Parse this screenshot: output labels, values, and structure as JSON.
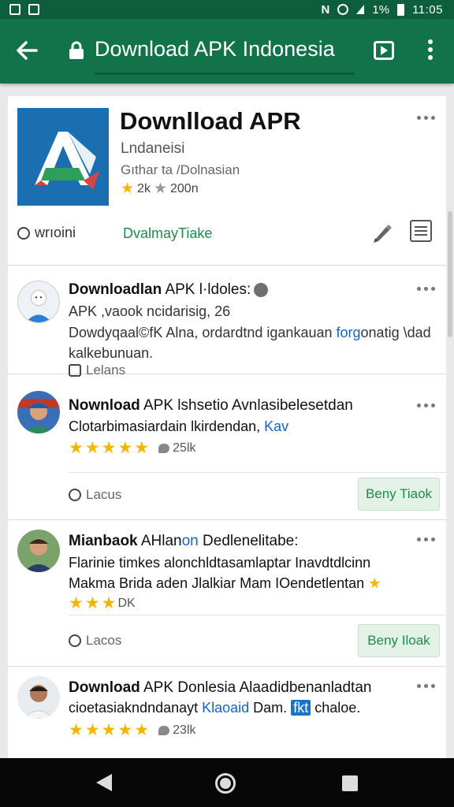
{
  "status_bar": {
    "signal_text": "1%",
    "time": "11:05"
  },
  "toolbar": {
    "back_icon": "arrow-left-icon",
    "lock_icon": "lock-icon",
    "title": "Download APK Indonesia",
    "tabs_icon": "tabs-icon",
    "menu_icon": "more-vert-icon"
  },
  "app": {
    "title": "Downlload APR",
    "subtitle": "Lndaneisi",
    "category": "Gıthar ta /Dolnasian",
    "rating": "2k",
    "downloads": "200n",
    "action_left": "wrıoini",
    "action_green": "DvalmayTiake",
    "icon_colors": {
      "bg": "#1b6fb0",
      "a": "#2f9e5a"
    }
  },
  "reviews": [
    {
      "name_bold": "Downloadlan",
      "name_rest": " APK l·ldoles:",
      "line1": "APK ,vaook ncidarisig, 26",
      "line2_pre": "Dowdyqaal©fK Alna, ordardtnd igankauan ",
      "line2_hl": "forg",
      "line2_post": "onatig \\dad",
      "line3": "kalkebunuan.",
      "meta": "Lelans"
    },
    {
      "name_bold": "Nownload",
      "name_rest": " APK lshsetio Avnlasibelesetdan",
      "line1_pre": "Clotarbimasiardain lkirdendan, ",
      "line1_hl": "Kav",
      "stars": 5,
      "count": "25lk",
      "meta": "Lacus",
      "button": "Beny Tiaok"
    },
    {
      "name_bold": "Mianbaok",
      "name_mid": " AHlan",
      "name_hl": "on",
      "name_rest": " Dedlenelitabe:",
      "line1": "Flarinie timkes alonchldtasamlaptar Inavdtdlcinn",
      "line2": "Makma Brida aden Jlalkiar Mam IOendetlentan",
      "stars": 3,
      "count": "DK",
      "meta": "Lacos",
      "button": "Beny Iloak"
    },
    {
      "name_bold": "Download",
      "name_rest": " APK Donlesia Alaadidbenanladtan",
      "line1_pre": "cioetasiakndndanayt ",
      "line1_hl": "Klaoaid",
      "line1_mid": " Dam. ",
      "line1_box": "fkt",
      "line1_post": " chaloe.",
      "stars": 5,
      "count": "23lk"
    }
  ],
  "nav": {
    "back_icon": "nav-back-icon",
    "home_icon": "nav-home-icon",
    "recent_icon": "nav-recents-icon"
  }
}
